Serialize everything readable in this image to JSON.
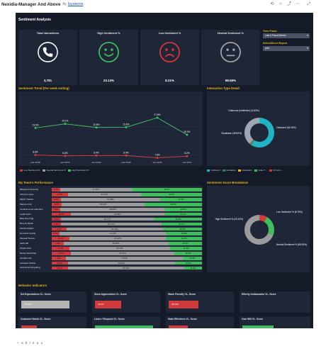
{
  "page": {
    "title": "Nexidia-Manager And Above",
    "by": "by",
    "author": "Isystems",
    "footer_brand": "+ a b l e a u"
  },
  "dashboard": {
    "title": "Sentiment Analysis",
    "kpis": [
      {
        "label": "Total Interactions",
        "value": "3,781",
        "icon": "phone-icon"
      },
      {
        "label": "High Sentiment %",
        "value": "23.14%",
        "icon": "smile-icon"
      },
      {
        "label": "Low Sentiment %",
        "value": "8.21%",
        "icon": "frown-icon"
      },
      {
        "label": "Neutral Sentiment %",
        "value": "68.56%",
        "icon": "neutral-face-icon"
      }
    ],
    "filters": {
      "time_frame_label": "Time Frame",
      "time_frame_value": "Last 6 Fiscal Weeks",
      "select_report_label": "Select/Direct Report",
      "select_report_value": "(All)"
    },
    "trend_title": "Sentiment Trend (Per week ending)",
    "interaction_title": "Interaction Type Detail",
    "team_title": "My Team's Performance",
    "score_title": "Sentiment Score Breakdown",
    "behavior_title": "Behavior Indicators"
  },
  "colors": {
    "high": "#3fbf5b",
    "neutral": "#9b9b9b",
    "low": "#d23b3b",
    "accent": "#e8b71a",
    "teal": "#1fb3c4"
  },
  "chart_data": [
    {
      "type": "line",
      "title": "Sentiment Trend (Per week ending)",
      "categories": [
        "w/e 10/08",
        "w/e 10/15",
        "w/e 10/22",
        "w/e 10/29",
        "w/e 11/05",
        "w/e 11/12"
      ],
      "series": [
        {
          "name": "Low Sentiment %",
          "values": [
            8.6,
            8.3,
            8.4,
            8.4,
            7.6,
            8.2
          ],
          "labels": [
            "8.6%",
            "8.3%",
            "8.4%",
            "8.4%",
            "7.6%",
            "8.2%"
          ]
        },
        {
          "name": "Neutral Sentiment %",
          "values": [
            68.0,
            67.0,
            68.2,
            68.1,
            69.2,
            71.0
          ],
          "labels": [],
          "hidden": true
        },
        {
          "name": "High Sentiment %",
          "values": [
            23.3,
            25.1,
            23.5,
            23.6,
            27.8,
            20.3
          ],
          "labels": [
            "23.3%",
            "25.1%",
            "23.5%",
            "23.6%",
            "27.8%",
            "20.3%"
          ]
        }
      ],
      "legend": "bottom"
    },
    {
      "type": "pie",
      "title": "Interaction Type Detail",
      "slices": [
        {
          "name": "Outbound",
          "value": 59.15,
          "label": "Outbound (59.15%)"
        },
        {
          "name": "Inbound",
          "value": 0.63,
          "label": ""
        },
        {
          "name": "Escalation",
          "value": 0.3,
          "label": ""
        },
        {
          "name": "Video Int...",
          "value": 0.8,
          "label": ""
        },
        {
          "name": "Outbound (Ineffective)",
          "value": 0.6,
          "label": ""
        },
        {
          "name": "Inbound",
          "value": 38.52,
          "label": "Inbound (38.52%)"
        }
      ],
      "labels_text": {
        "top": "Outbound (Ineffective) (0.83%)",
        "left": "Escalation (38.52%)",
        "right": "Outbound (59.15%)"
      },
      "legend": [
        "Outbound",
        "Escalation",
        "Relocation",
        "Video T...",
        "Ot Conn..."
      ],
      "legend_colors": [
        "#1fb3c4",
        "#2b7a88",
        "#e8b71a",
        "#3fbf5b",
        "#d23b3b"
      ]
    },
    {
      "type": "bar",
      "title": "My Team's Performance",
      "stacked": true,
      "categories": [
        "Behaviors Kennedy",
        "Johnnie Lopez",
        "Martin Thizard",
        "Marcus Ortiz",
        "Carolina Lover-Hampton",
        "Leslie Dunn",
        "Bear Hoy Figg",
        "Beverly Martin",
        "Keisha Pollard",
        "Dominick Cecilia",
        "Maxwell Tovera",
        "Aleth Hill",
        "Phyllis Price",
        "Randy Rosenthal",
        "Jennifer Kail",
        "Lashawn Dobbie",
        "Jessica Fleming Berg"
      ],
      "series": [
        {
          "name": "Low Sentiment %",
          "values": [
            5.7,
            11.2,
            6.0,
            6.8,
            5.8,
            12.2,
            6.1,
            6.2,
            9.7,
            5.1,
            12.2,
            7.8,
            11.9,
            12.7,
            9.5,
            11.1,
            10.9
          ]
        },
        {
          "name": "Neutral Sentiment %",
          "values": [
            47.41,
            51.22,
            67.08,
            55.62,
            68.86,
            60.63,
            62.77,
            66.72,
            64.14,
            71.01,
            65.12,
            69.82,
            66.79,
            68.14,
            77.62,
            72.89,
            78.16
          ]
        },
        {
          "name": "High Sentiment %",
          "values": [
            46.9,
            42.5,
            27.9,
            38.6,
            24.4,
            24.1,
            32.2,
            27.1,
            25.9,
            23.9,
            24.3,
            22.3,
            21.3,
            18.1,
            12.9,
            18.6,
            11.9
          ]
        }
      ]
    },
    {
      "type": "pie",
      "title": "Sentiment Score Breakdown",
      "slices": [
        {
          "name": "Low Sentiment %",
          "value": 8.76,
          "label": "Low Sentiment % (8.76%)"
        },
        {
          "name": "High Sentiment %",
          "value": 22.34,
          "label": "High Sentiment % (22.34%)"
        },
        {
          "name": "Neutral Sentiment %",
          "value": 68.9,
          "label": "Neutral Sentiment % (68.90%)"
        }
      ]
    },
    {
      "type": "bar",
      "title": "Behavior Indicators",
      "categories": [
        "Set Expectations VL- Score",
        "Show Appreciation VL- Score",
        "Warm Friendly VL- Score",
        "Effortly Ambassador VL- Score",
        "Customer Needs VL- Score",
        "Listen / Respond VL- Score",
        "State Effectives VL- Score",
        "Own Will VL- Score"
      ],
      "values": [
        79.5,
        42.9,
        48.3,
        0,
        25.3,
        95.8,
        31.5,
        51.3
      ],
      "labels": [
        "79.63%",
        "42.9%",
        "48.33%",
        "",
        "25.3%",
        "95.8%",
        "31.5%",
        "51.3%"
      ],
      "colors": [
        "#b3b3b3",
        "#d23b3b",
        "#d23b3b",
        "#1e2638",
        "#d23b3b",
        "#3fbf5b",
        "#d23b3b",
        "#3fbf5b"
      ]
    }
  ]
}
